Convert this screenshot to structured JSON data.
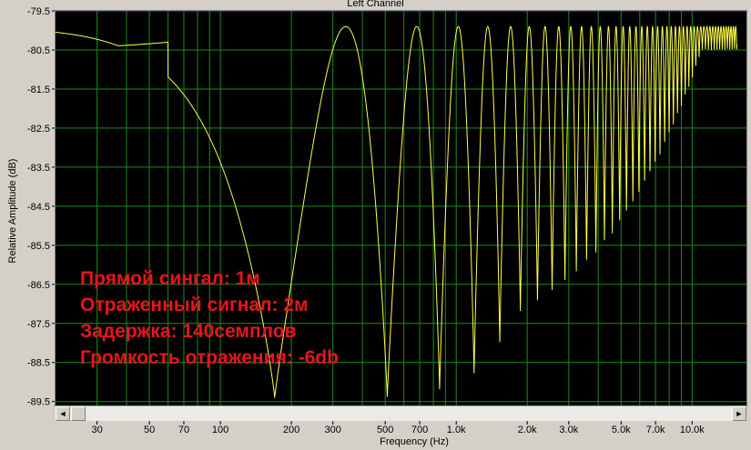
{
  "chart_data": {
    "type": "line",
    "title": "Left Channel",
    "xlabel": "Frequency (Hz)",
    "ylabel": "Relative Amplitude (dB)",
    "x_scale": "log",
    "xlim": [
      20,
      17000
    ],
    "ylim": [
      -89.6,
      -79.5
    ],
    "x_ticks": [
      {
        "value": 30,
        "label": "30"
      },
      {
        "value": 50,
        "label": "50"
      },
      {
        "value": 70,
        "label": "70"
      },
      {
        "value": 100,
        "label": "100"
      },
      {
        "value": 200,
        "label": "200"
      },
      {
        "value": 300,
        "label": "300"
      },
      {
        "value": 500,
        "label": "500"
      },
      {
        "value": 700,
        "label": "700"
      },
      {
        "value": 1000,
        "label": "1.0k"
      },
      {
        "value": 2000,
        "label": "2.0k"
      },
      {
        "value": 3000,
        "label": "3.0k"
      },
      {
        "value": 5000,
        "label": "5.0k"
      },
      {
        "value": 7000,
        "label": "7.0k"
      },
      {
        "value": 10000,
        "label": "10.0k"
      }
    ],
    "y_ticks": [
      {
        "value": -79.5,
        "label": "-79.5"
      },
      {
        "value": -80.5,
        "label": "-80.5"
      },
      {
        "value": -81.5,
        "label": "-81.5"
      },
      {
        "value": -82.5,
        "label": "-82.5"
      },
      {
        "value": -83.5,
        "label": "-83.5"
      },
      {
        "value": -84.5,
        "label": "-84.5"
      },
      {
        "value": -85.5,
        "label": "-85.5"
      },
      {
        "value": -86.5,
        "label": "-86.5"
      },
      {
        "value": -87.5,
        "label": "-87.5"
      },
      {
        "value": -88.5,
        "label": "-88.5"
      },
      {
        "value": -89.5,
        "label": "-89.5"
      }
    ],
    "grid": true,
    "series": [
      {
        "peak_db": -79.9,
        "first_notch_hz": 170,
        "notch_spacing_hz": 340,
        "notch_depths_db": [
          -89.4,
          -89.4,
          -89.2,
          -88.8,
          -88.0,
          -87.2
        ],
        "low_freq_db": -80.3
      }
    ],
    "colors": {
      "plot_bg": "#000000",
      "grid": "#1a8c1a",
      "line": "#ffff4d",
      "frame_bg": "#d4d0c8"
    }
  },
  "annotation": {
    "lines": [
      "Прямой сингал: 1м",
      "Отраженный сигнал: 2м",
      "Задержка: 140семплов",
      "Громкость отражения: -6db"
    ],
    "color": "#e8151b"
  },
  "scrollbar": {
    "left_arrow": "◄",
    "right_arrow": "►"
  }
}
